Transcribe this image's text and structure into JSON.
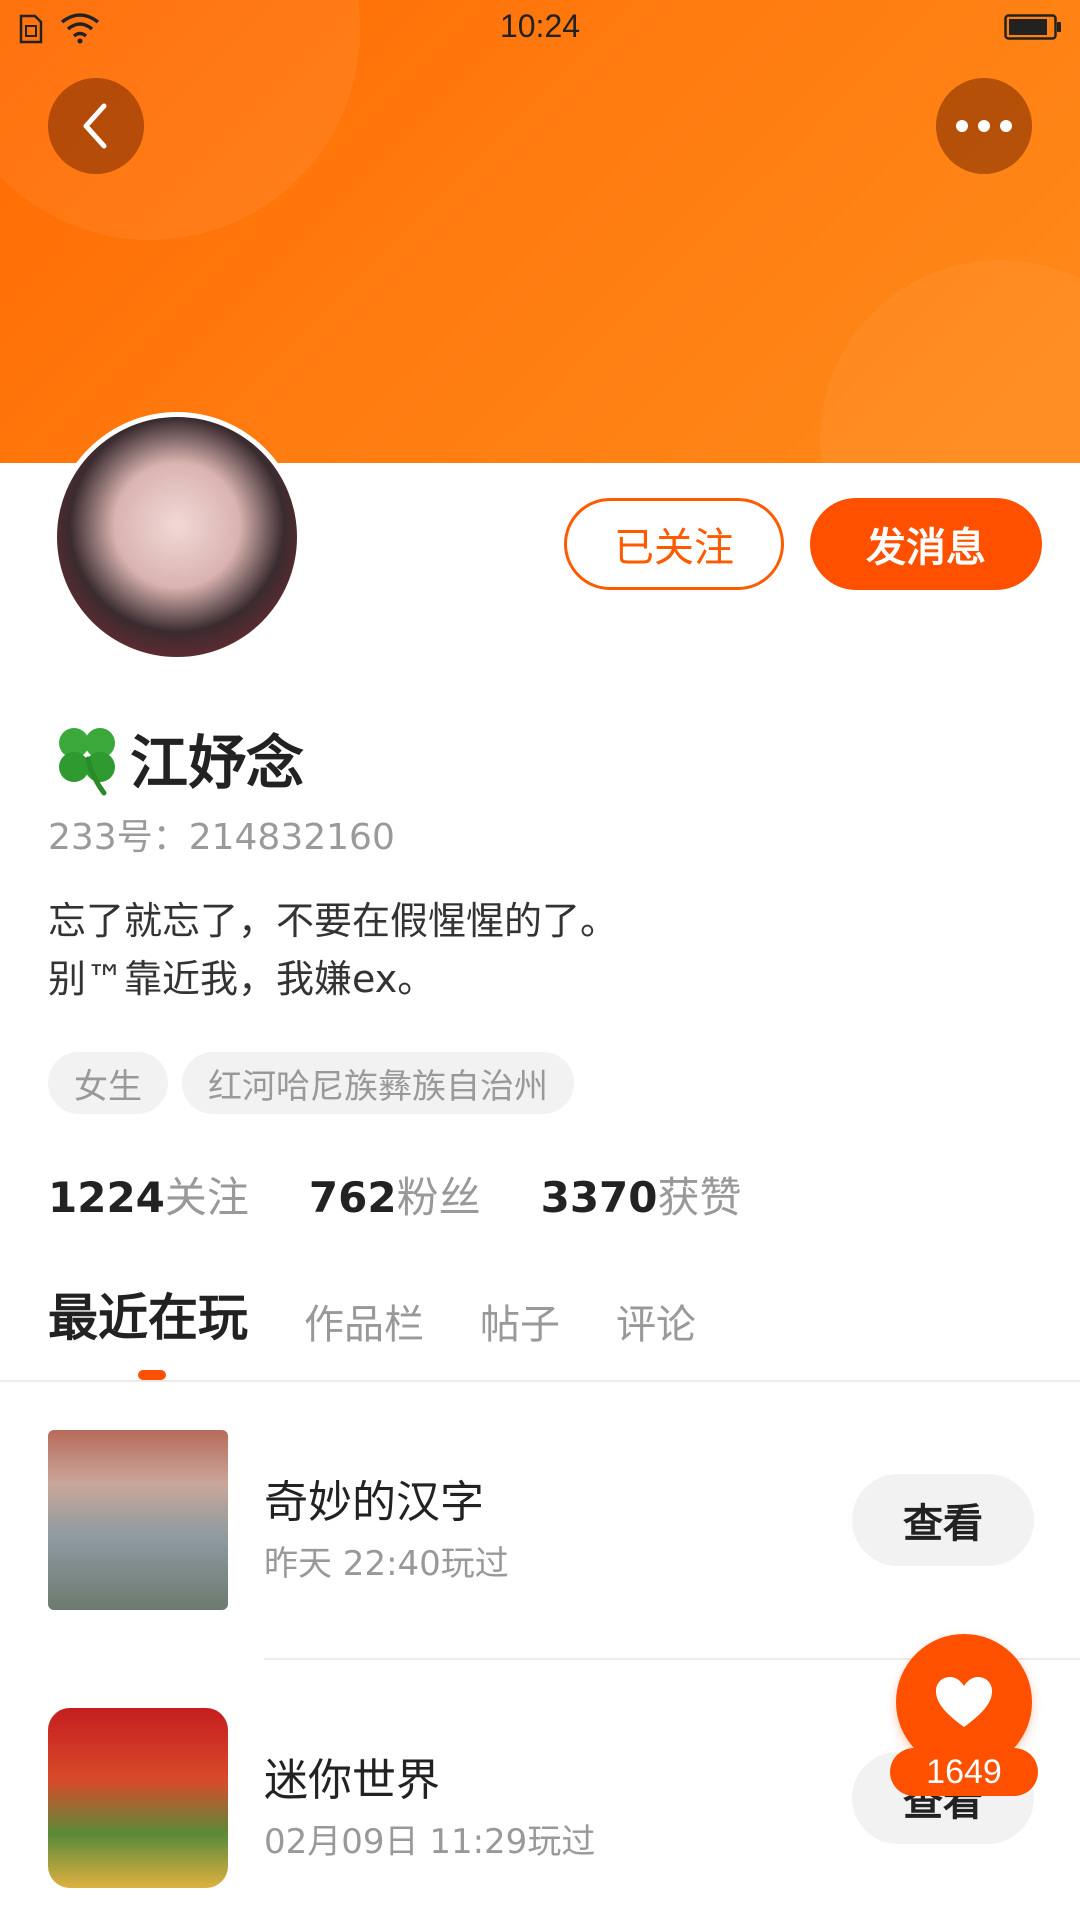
{
  "status_bar": {
    "time": "10:24"
  },
  "header": {
    "back_icon": "chevron-left-icon",
    "more_icon": "more-dots-icon"
  },
  "profile": {
    "name_emoji_icon": "four-leaf-clover-icon",
    "name": "江妤念",
    "uid": "233号：214832160",
    "bio_line1": "忘了就忘了，不要在假惺惺的了。",
    "bio_line2": "别™靠近我，我嫌ex。",
    "tags": [
      "女生",
      "红河哈尼族彝族自治州"
    ],
    "follow_state_label": "已关注",
    "message_label": "发消息"
  },
  "stats": [
    {
      "count": "1224",
      "label": "关注"
    },
    {
      "count": "762",
      "label": "粉丝"
    },
    {
      "count": "3370",
      "label": "获赞"
    }
  ],
  "tabs": [
    {
      "label": "最近在玩",
      "active": true
    },
    {
      "label": "作品栏",
      "active": false
    },
    {
      "label": "帖子",
      "active": false
    },
    {
      "label": "评论",
      "active": false
    }
  ],
  "games": [
    {
      "title": "奇妙的汉字",
      "time": "昨天 22:40玩过",
      "action": "查看"
    },
    {
      "title": "迷你世界",
      "time": "02月09日 11:29玩过",
      "action": "查看"
    }
  ],
  "like_fab": {
    "icon": "heart-icon",
    "count": "1649"
  },
  "colors": {
    "accent": "#ff5000",
    "banner": "#ff7a10",
    "muted": "#999999"
  }
}
